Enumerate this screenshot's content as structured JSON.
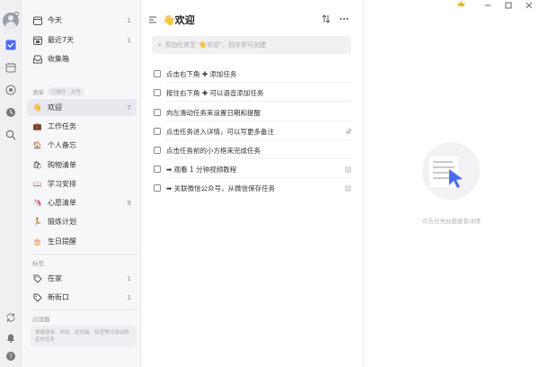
{
  "sidebar": {
    "smart_lists": [
      {
        "label": "今天",
        "count": "1",
        "icon": "calendar-today-icon"
      },
      {
        "label": "最近7天",
        "count": "1",
        "icon": "calendar-week-icon"
      },
      {
        "label": "收集箱",
        "count": "",
        "icon": "inbox-icon"
      }
    ],
    "lists_header": "清单",
    "lists_tag": "已展开 · 头号",
    "lists": [
      {
        "label": "欢迎",
        "count": "7",
        "emoji": "👋",
        "active": true
      },
      {
        "label": "工作任务",
        "count": "",
        "emoji": "💼"
      },
      {
        "label": "个人备忘",
        "count": "",
        "emoji": "🏠"
      },
      {
        "label": "购物清单",
        "count": "",
        "emoji": "🛍"
      },
      {
        "label": "学习安排",
        "count": "",
        "emoji": "📖"
      },
      {
        "label": "心愿清单",
        "count": "9",
        "emoji": "🦄"
      },
      {
        "label": "锻炼计划",
        "count": "",
        "emoji": "🏃"
      },
      {
        "label": "生日提醒",
        "count": "",
        "emoji": "🎂"
      }
    ],
    "tags_header": "标签",
    "tags": [
      {
        "label": "在家",
        "count": "1"
      },
      {
        "label": "新街口",
        "count": "1"
      }
    ],
    "filters_header": "过滤器",
    "filters_hint": "根据清单、时间、优先级、标签等过滤出特定的任务"
  },
  "main": {
    "title": "欢迎",
    "title_emoji": "👋",
    "add_placeholder": "+ 添加任务至\"👋欢迎\"，回车即可创建",
    "tasks": [
      {
        "text": "点击右下角 ✚ 添加任务",
        "side": ""
      },
      {
        "text": "按住右下角 ✚ 可以语音添加任务",
        "side": ""
      },
      {
        "text": "向左滑动任务来设置日期和提醒",
        "side": ""
      },
      {
        "text": "点击任务进入详情，可以写更多备注",
        "side": "attachment-icon"
      },
      {
        "text": "点击任务前的小方框来完成任务",
        "side": ""
      },
      {
        "text": "➡ 观看 1 分钟视频教程",
        "side": "note-icon"
      },
      {
        "text": "➡ 关联微信公众号，从微信保存任务",
        "side": "note-icon"
      }
    ]
  },
  "detail": {
    "hint": "点击任务标题查看详情"
  },
  "colors": {
    "accent": "#4a6cf7",
    "crown": "#f2b01e"
  }
}
